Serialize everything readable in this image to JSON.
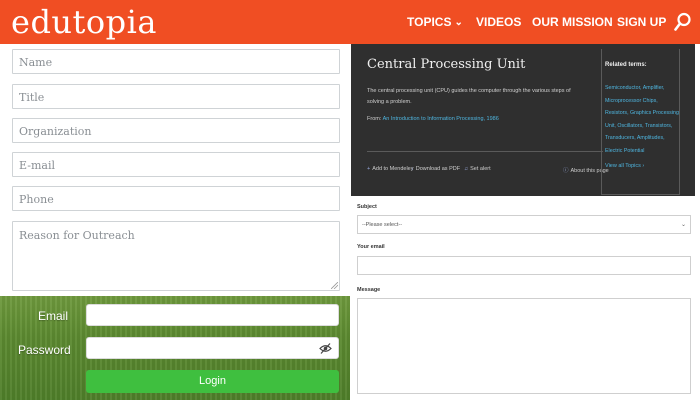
{
  "header": {
    "logo": "edutopia",
    "nav": [
      {
        "label": "TOPICS"
      },
      {
        "label": "VIDEOS"
      },
      {
        "label": "OUR MISSION"
      },
      {
        "label": "SIGN UP"
      }
    ],
    "brand_color": "#f04e23"
  },
  "outreach_form": {
    "name_placeholder": "Name",
    "title_placeholder": "Title",
    "organization_placeholder": "Organization",
    "email_placeholder": "E-mail",
    "phone_placeholder": "Phone",
    "reason_placeholder": "Reason for Outreach"
  },
  "login": {
    "email_label": "Email",
    "password_label": "Password",
    "button_label": "Login",
    "button_color": "#3fbf3f"
  },
  "definition": {
    "title": "Central Processing Unit",
    "description": "The central processing unit (CPU) guides the computer through the various steps of solving a problem.",
    "from_label": "From:",
    "from_source": "An Introduction to Information Processing, 1986",
    "actions": {
      "mendeley": "Add to Mendeley",
      "pdf": "Download as PDF",
      "alert": "Set alert",
      "about": "About this page"
    },
    "related_heading": "Related terms:",
    "related_terms": "Semiconductor, Amplifier, Microprocessor Chips, Resistors, Graphics Processing Unit, Oscillators, Transistors, Transducers, Amplitudes, Electric Potential",
    "view_all": "View all Topics"
  },
  "contact_form": {
    "subject_label": "Subject",
    "subject_value": "--Please select--",
    "email_label": "Your email",
    "message_label": "Message"
  }
}
